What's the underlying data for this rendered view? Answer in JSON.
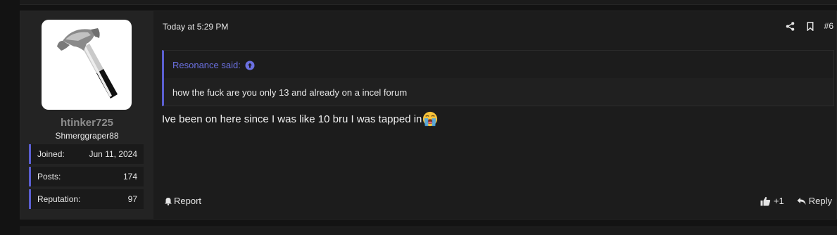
{
  "post": {
    "timestamp": "Today at 5:29 PM",
    "post_number": "#6",
    "message": "Ive been on here since I was like 10 bru I was tapped in"
  },
  "user": {
    "username": "htinker725",
    "title": "Shmerggraper88",
    "stats": [
      {
        "label": "Joined:",
        "value": "Jun 11, 2024"
      },
      {
        "label": "Posts:",
        "value": "174"
      },
      {
        "label": "Reputation:",
        "value": "97"
      }
    ]
  },
  "quote": {
    "author": "Resonance said:",
    "text": "how the fuck are you only 13 and already on a incel forum"
  },
  "footer": {
    "report_label": "Report",
    "like_count": "+1",
    "reply_label": "Reply"
  },
  "icons": {
    "share": "share-icon",
    "bookmark": "bookmark-icon",
    "quote_up": "arrow-up-circle-icon",
    "report": "bell-icon",
    "like": "thumbs-up-icon",
    "reply": "reply-icon",
    "emoji": "loudly-crying-face-emoji"
  },
  "colors": {
    "accent": "#5b5fd1",
    "quote_author": "#6b70e0",
    "background": "#131313"
  }
}
